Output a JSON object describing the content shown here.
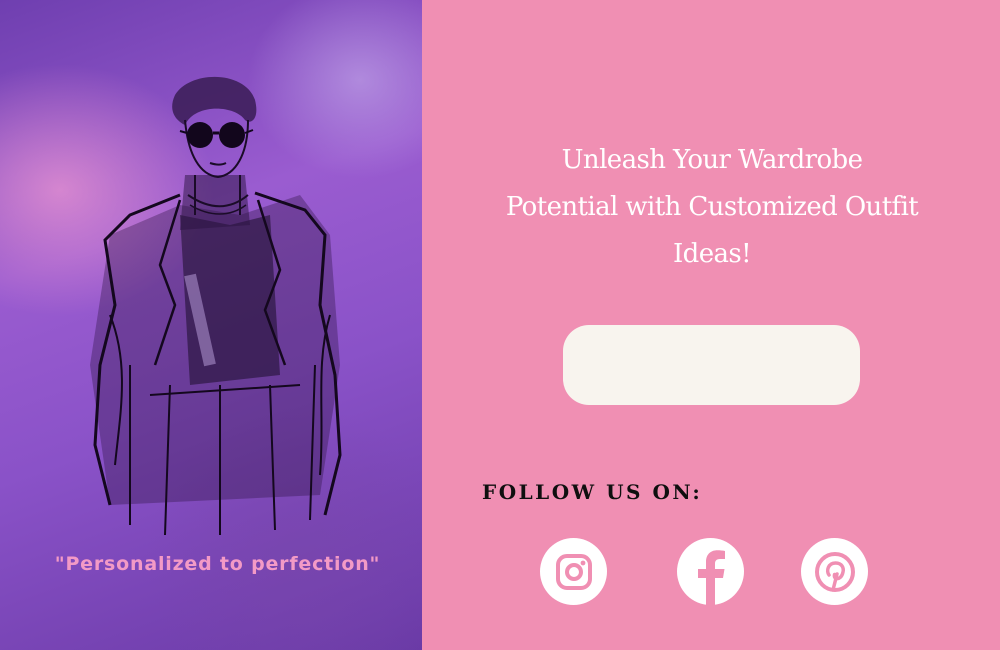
{
  "left": {
    "tagline": "\"Personalized to perfection\""
  },
  "right": {
    "headline": "Unleash Your Wardrobe Potential with Customized Outfit Ideas!",
    "cta_label": "",
    "follow_label": "FOLLOW US ON:",
    "social": [
      {
        "icon": "instagram-icon"
      },
      {
        "icon": "facebook-icon"
      },
      {
        "icon": "pinterest-icon"
      }
    ]
  },
  "colors": {
    "left_bg": "#8a52c8",
    "right_bg": "#f08fb3",
    "tagline": "#f39ac6",
    "headline": "#ffffff",
    "button_bg": "#f8f4ee",
    "icon_fg": "#f08fb3"
  }
}
